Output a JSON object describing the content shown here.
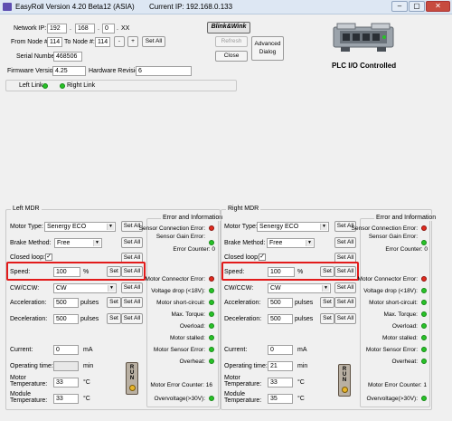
{
  "titlebar": {
    "title": "EasyRoll Version 4.20 Beta12 (ASIA)",
    "current_ip": "Current IP: 192.168.0.133"
  },
  "network": {
    "ip_label": "Network IP:",
    "ip1": "192",
    "ip2": "168",
    "ip3": "0",
    "ip4": "XX",
    "from_label": "From Node #:",
    "from_value": "114",
    "to_label": "To Node #:",
    "to_value": "114",
    "minus": "-",
    "plus": "+",
    "set_all": "Set All",
    "serial_label": "Serial Number:",
    "serial_value": "468506",
    "firmware_label": "Firmware Version:",
    "firmware_value": "4.25",
    "hardware_label": "Hardware Revision:",
    "hardware_value": "6",
    "left_link": "Left Link",
    "right_link": "Right Link"
  },
  "toolbar": {
    "blink": "Blink&Wink",
    "refresh": "Refresh",
    "close": "Close",
    "advanced": "Advanced Dialog",
    "plc_label": "PLC I/O Controlled"
  },
  "left_mdr": {
    "title": "Left MDR",
    "motor_type_label": "Motor Type:",
    "motor_type": "Senergy ECO",
    "brake_label": "Brake Method:",
    "brake": "Free",
    "closed_loop_label": "Closed loop:",
    "closed_loop_check": "✓",
    "speed_label": "Speed:",
    "speed_value": "100",
    "speed_unit": "%",
    "set": "Set",
    "set_all": "Set All",
    "cw_label": "CW/CCW:",
    "cw_value": "CW",
    "accel_label": "Acceleration:",
    "accel_value": "500",
    "accel_unit": "pulses",
    "decel_label": "Deceleration:",
    "decel_value": "500",
    "decel_unit": "pulses",
    "current_label": "Current:",
    "current_value": "0",
    "current_unit": "mA",
    "optime_label": "Operating time:",
    "optime_value": "",
    "optime_unit": "min",
    "motor_temp_label": "Motor Temperature:",
    "motor_temp_value": "33",
    "motor_temp_unit": "°C",
    "module_temp_label": "Module Temperature:",
    "module_temp_value": "33",
    "module_temp_unit": "°C",
    "run_label": "RUN"
  },
  "left_info": {
    "title": "Error and Information",
    "sensor_conn": "Sensor Connection Error:",
    "sensor_gain": "Sensor Gain Error:",
    "error_counter": "Error Counter: 0",
    "motor_conn": "Motor Connector Error:",
    "voltage_drop": "Voltage drop (<18V):",
    "short_circuit": "Motor short-circuit:",
    "max_torque": "Max. Torque:",
    "overload": "Overload:",
    "stalled": "Motor stalled:",
    "motor_sensor": "Motor Sensor Error:",
    "overheat": "Overheat:",
    "motor_error_counter": "Motor Error Counter: 16",
    "overvoltage": "Overvoltage(>30V):"
  },
  "right_mdr": {
    "title": "Right MDR",
    "motor_type_label": "Motor Type:",
    "motor_type": "Senergy ECO",
    "brake_label": "Brake Method:",
    "brake": "Free",
    "closed_loop_label": "Closed loop:",
    "closed_loop_check": "✓",
    "speed_label": "Speed:",
    "speed_value": "100",
    "speed_unit": "%",
    "set": "Set",
    "set_all": "Set All",
    "cw_label": "CW/CCW:",
    "cw_value": "CW",
    "accel_label": "Acceleration:",
    "accel_value": "500",
    "accel_unit": "pulses",
    "decel_label": "Deceleration:",
    "decel_value": "500",
    "decel_unit": "pulses",
    "current_label": "Current:",
    "current_value": "0",
    "current_unit": "mA",
    "optime_label": "Operating time:",
    "optime_value": "21",
    "optime_unit": "min",
    "motor_temp_label": "Motor Temperature:",
    "motor_temp_value": "33",
    "motor_temp_unit": "°C",
    "module_temp_label": "Module Temperature:",
    "module_temp_value": "35",
    "module_temp_unit": "°C",
    "run_label": "RUN"
  },
  "right_info": {
    "title": "Error and Information",
    "sensor_conn": "Sensor Connection Error:",
    "sensor_gain": "Sensor Gain Error:",
    "error_counter": "Error Counter: 0",
    "motor_conn": "Motor Connector Error:",
    "voltage_drop": "Voltage drop (<18V):",
    "short_circuit": "Motor short-circuit:",
    "max_torque": "Max. Torque:",
    "overload": "Overload:",
    "stalled": "Motor stalled:",
    "motor_sensor": "Motor Sensor Error:",
    "overheat": "Overheat:",
    "motor_error_counter": "Motor Error Counter: 1",
    "overvoltage": "Overvoltage(>30V):"
  },
  "colors": {
    "led_ok": "#27c227",
    "led_error": "#e12a1e",
    "highlight": "#e21b1b"
  }
}
